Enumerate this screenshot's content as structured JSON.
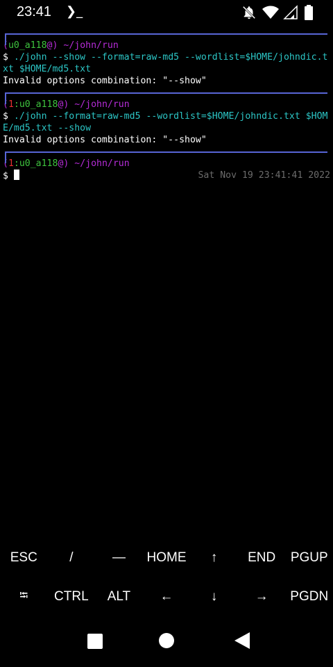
{
  "statusbar": {
    "time": "23:41",
    "app_icon": "terminal-prompt-icon",
    "icons": [
      "bell-off-icon",
      "wifi-icon",
      "signal-icon",
      "battery-icon"
    ]
  },
  "terminal": {
    "blocks": [
      {
        "open": "(",
        "status": "",
        "user": "u0_a118",
        "at": "@",
        "close": ")",
        "path": " ~/john/run",
        "cmd1_prompt": "$ ",
        "cmd1_exec": "./john",
        "cmd1_args_a": " --show --format=raw-md5 --wordlist=",
        "cmd1_var": "$HOME",
        "cmd1_args_b": "/johndic.t",
        "cmd2_a": "xt ",
        "cmd2_var": "$HOME",
        "cmd2_b": "/md5.txt",
        "output": "Invalid options combination: \"--show\""
      },
      {
        "open": "(",
        "status": "1",
        "sep": ":",
        "user": "u0_a118",
        "at": "@",
        "close": ")",
        "path": " ~/john/run",
        "cmd1_prompt": "$ ",
        "cmd1_exec": "./john",
        "cmd1_args_a": " --format=raw-md5 --wordlist=",
        "cmd1_var": "$HOME",
        "cmd1_args_b": "/johndic.txt ",
        "cmd1_var2": "$HOM",
        "cmd2_var": "E",
        "cmd2_b": "/md5.txt --show",
        "output": "Invalid options combination: \"--show\""
      },
      {
        "open": "(",
        "status": "1",
        "sep": ":",
        "user": "u0_a118",
        "at": "@",
        "close": ")",
        "path": " ~/john/run",
        "prompt": "$ ",
        "date": "Sat Nov 19 23:41:41 2022"
      }
    ]
  },
  "extra_keys": {
    "row1": [
      "ESC",
      "/",
      "—",
      "HOME",
      "↑",
      "END",
      "PGUP"
    ],
    "row2": [
      "⭾",
      "CTRL",
      "ALT",
      "←",
      "↓",
      "→",
      "PGDN"
    ]
  },
  "navbar": {
    "buttons": [
      "recents-square-icon",
      "home-circle-icon",
      "back-triangle-icon"
    ]
  }
}
